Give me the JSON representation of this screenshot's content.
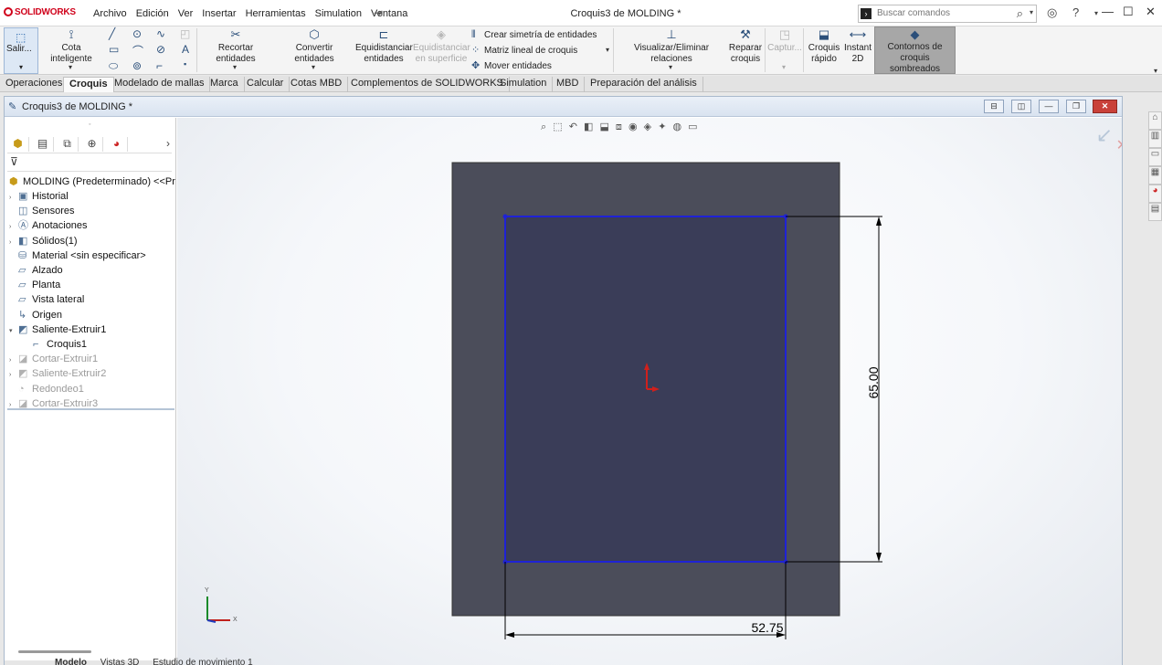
{
  "app": {
    "logo": "SOLIDWORKS",
    "document_title": "Croquis3 de MOLDING *",
    "menu": [
      "Archivo",
      "Edición",
      "Ver",
      "Insertar",
      "Herramientas",
      "Simulation",
      "Ventana"
    ],
    "search_placeholder": "Buscar comandos"
  },
  "command_manager": {
    "exit_sketch": "Salir...",
    "smart_dimension": "Cota inteligente",
    "trim": "Recortar entidades",
    "convert": "Convertir entidades",
    "offset": "Equidistanciar entidades",
    "offset_surface": "Equidistanciar en superficie",
    "mirror": "Crear simetría de entidades",
    "linear_pattern": "Matriz lineal de croquis",
    "move": "Mover entidades",
    "relations": "Visualizar/Eliminar relaciones",
    "repair": "Reparar croquis",
    "capture": "Captur...",
    "quick_sketch": "Croquis rápido",
    "instant2d": "Instant 2D",
    "shaded_contours": "Contornos de croquis sombreados"
  },
  "tabs": [
    "Operaciones",
    "Croquis",
    "Modelado de mallas",
    "Marca",
    "Calcular",
    "Cotas MBD",
    "Complementos de SOLIDWORKS",
    "Simulation",
    "MBD",
    "Preparación del análisis"
  ],
  "active_tab": "Croquis",
  "document_window": {
    "title": "Croquis3 de MOLDING *"
  },
  "feature_tree": {
    "root": "MOLDING  (Predeterminado) <<Pr",
    "items": [
      {
        "label": "Historial",
        "icon": "history-icon",
        "expand": true,
        "faded": false,
        "indent": 0
      },
      {
        "label": "Sensores",
        "icon": "sensor-icon",
        "expand": false,
        "faded": false,
        "indent": 0
      },
      {
        "label": "Anotaciones",
        "icon": "annotations-icon",
        "expand": true,
        "faded": false,
        "indent": 0
      },
      {
        "label": "Sólidos(1)",
        "icon": "solid-bodies-icon",
        "expand": true,
        "faded": false,
        "indent": 0
      },
      {
        "label": "Material <sin especificar>",
        "icon": "material-icon",
        "expand": false,
        "faded": false,
        "indent": 0
      },
      {
        "label": "Alzado",
        "icon": "plane-icon",
        "expand": false,
        "faded": false,
        "indent": 0
      },
      {
        "label": "Planta",
        "icon": "plane-icon",
        "expand": false,
        "faded": false,
        "indent": 0
      },
      {
        "label": "Vista lateral",
        "icon": "plane-icon",
        "expand": false,
        "faded": false,
        "indent": 0
      },
      {
        "label": "Origen",
        "icon": "origin-icon",
        "expand": false,
        "faded": false,
        "indent": 0
      },
      {
        "label": "Saliente-Extruir1",
        "icon": "extrude-icon",
        "expand": true,
        "faded": false,
        "indent": 0
      },
      {
        "label": "Croquis1",
        "icon": "sketch-icon",
        "expand": false,
        "faded": false,
        "indent": 1
      },
      {
        "label": "Cortar-Extruir1",
        "icon": "cut-extrude-icon",
        "expand": true,
        "faded": true,
        "indent": 0
      },
      {
        "label": "Saliente-Extruir2",
        "icon": "extrude-icon",
        "expand": true,
        "faded": true,
        "indent": 0
      },
      {
        "label": "Redondeo1",
        "icon": "fillet-icon",
        "expand": false,
        "faded": true,
        "indent": 0
      },
      {
        "label": "Cortar-Extruir3",
        "icon": "cut-extrude-icon",
        "expand": true,
        "faded": true,
        "indent": 0
      }
    ]
  },
  "sketch": {
    "dimension_vertical": "65.00",
    "dimension_horizontal": "52.75",
    "triad_y": "Y",
    "triad_x": "X",
    "colors": {
      "body": "#4b4d5a",
      "sketch_line": "#1f22d6",
      "dimension": "#000000",
      "origin": "#d0201c"
    }
  },
  "bottom_tabs": [
    "Modelo",
    "Vistas 3D",
    "Estudio de movimiento 1"
  ]
}
